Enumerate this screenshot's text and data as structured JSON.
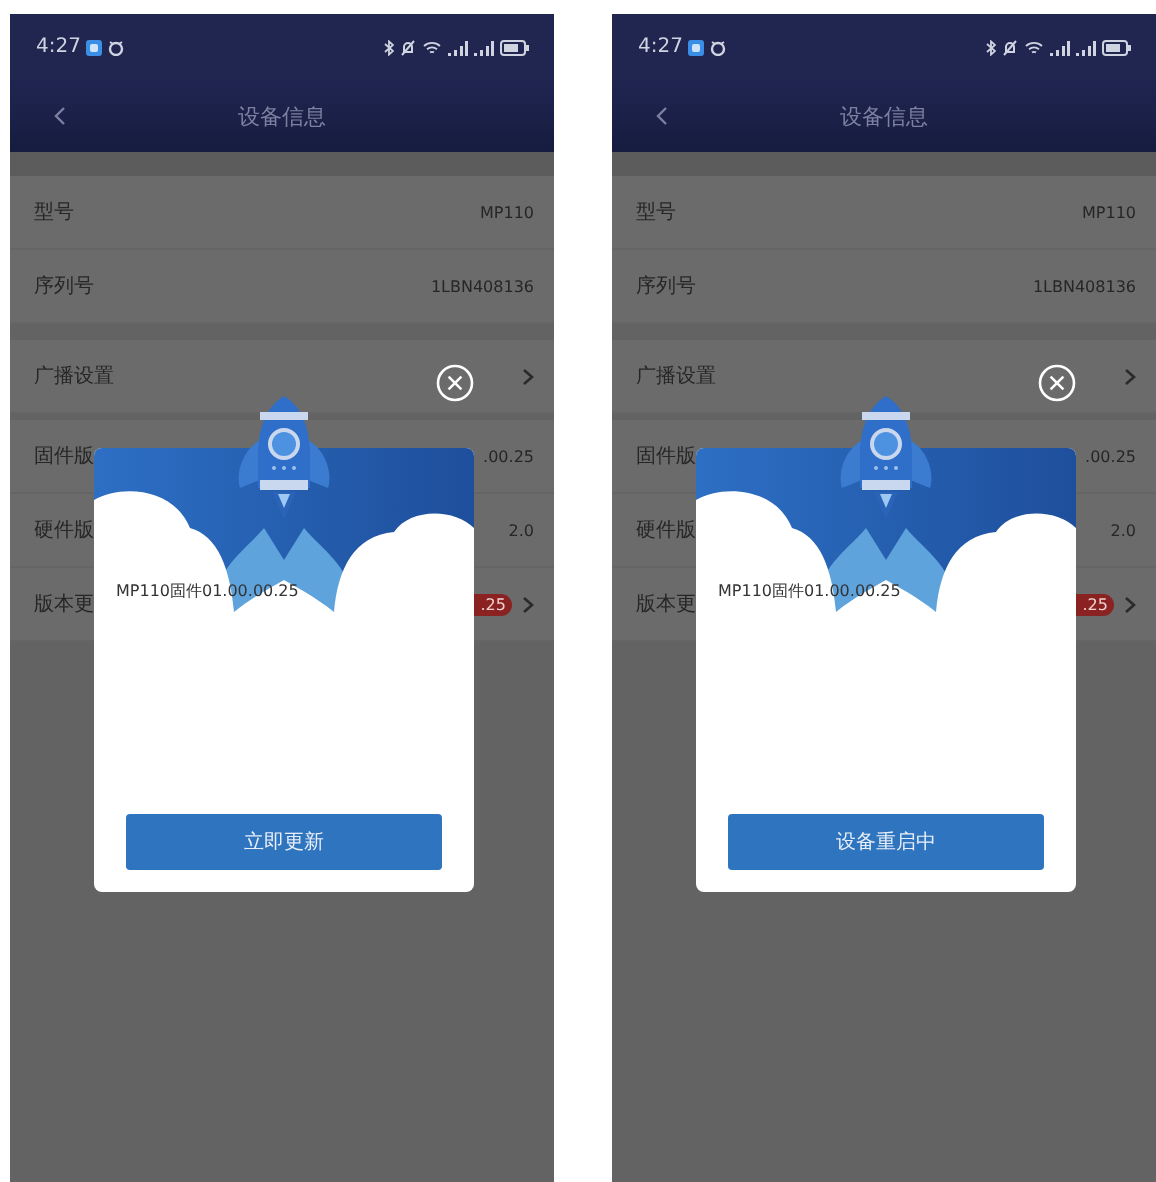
{
  "screens": [
    {
      "status_bar": {
        "time": "4:27"
      },
      "header": {
        "title": "设备信息"
      },
      "sections": [
        [
          {
            "kind": "value",
            "label": "型号",
            "value": "MP110"
          },
          {
            "kind": "value",
            "label": "序列号",
            "value": "1LBN408136"
          }
        ],
        [
          {
            "kind": "link",
            "label": "广播设置"
          }
        ],
        [
          {
            "kind": "value",
            "label": "固件版",
            "value": ".00.25"
          },
          {
            "kind": "value",
            "label": "硬件版",
            "value": "2.0"
          },
          {
            "kind": "badge",
            "label": "版本更",
            "value": ".25"
          }
        ]
      ],
      "dialog": {
        "message": "MP110固件01.00.00.25",
        "button": "立即更新"
      }
    },
    {
      "status_bar": {
        "time": "4:27"
      },
      "header": {
        "title": "设备信息"
      },
      "sections": [
        [
          {
            "kind": "value",
            "label": "型号",
            "value": "MP110"
          },
          {
            "kind": "value",
            "label": "序列号",
            "value": "1LBN408136"
          }
        ],
        [
          {
            "kind": "link",
            "label": "广播设置"
          }
        ],
        [
          {
            "kind": "value",
            "label": "固件版",
            "value": ".00.25"
          },
          {
            "kind": "value",
            "label": "硬件版",
            "value": "2.0"
          },
          {
            "kind": "badge",
            "label": "版本更",
            "value": ".25"
          }
        ]
      ],
      "dialog": {
        "message": "MP110固件01.00.00.25",
        "button": "设备重启中"
      }
    }
  ]
}
